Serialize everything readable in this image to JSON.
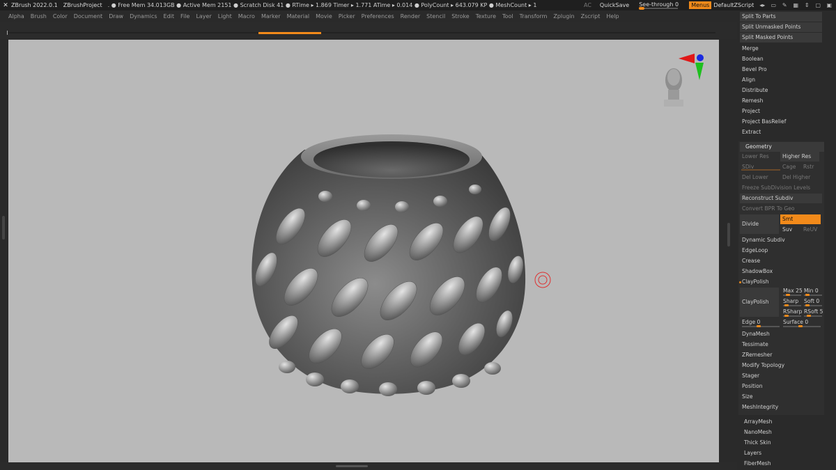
{
  "titlebar": {
    "app": "ZBrush 2022.0.1",
    "project": "ZBrushProject",
    "stats": ". ● Free Mem 34.013GB ● Active Mem 2151 ● Scratch Disk 41 ● RTime ▸ 1.869 Timer ▸ 1.771 ATime ▸ 0.014 ● PolyCount ▸ 643.079 KP ● MeshCount ▸ 1",
    "ac": "AC",
    "quicksave": "QuickSave",
    "seethrough": "See-through  0",
    "menus": "Menus",
    "default_zscript": "DefaultZScript"
  },
  "menubar": [
    "Alpha",
    "Brush",
    "Color",
    "Document",
    "Draw",
    "Dynamics",
    "Edit",
    "File",
    "Layer",
    "Light",
    "Macro",
    "Marker",
    "Material",
    "Movie",
    "Picker",
    "Preferences",
    "Render",
    "Stencil",
    "Stroke",
    "Texture",
    "Tool",
    "Transform",
    "Zplugin",
    "Zscript",
    "Help"
  ],
  "subtool_top": [
    "Split To Parts",
    "Split Unmasked Points",
    "Split Masked Points"
  ],
  "subtool_list": [
    "Merge",
    "Boolean",
    "Bevel Pro",
    "Align",
    "Distribute",
    "Remesh",
    "Project",
    "Project BasRelief",
    "Extract"
  ],
  "geometry": {
    "header": "Geometry",
    "lower_res": "Lower Res",
    "higher_res": "Higher Res",
    "sdiv": "SDiv",
    "cage": "Cage",
    "rstr": "Rstr",
    "del_lower": "Del Lower",
    "del_higher": "Del Higher",
    "freeze": "Freeze SubDivision Levels",
    "reconstruct": "Reconstruct Subdiv",
    "convert_bpr": "Convert BPR To Geo",
    "divide": "Divide",
    "smt": "Smt",
    "suv": "Suv",
    "reuv": "ReUV",
    "items": [
      "Dynamic Subdiv",
      "EdgeLoop",
      "Crease",
      "ShadowBox"
    ],
    "claypolish_toggle": "ClayPolish",
    "claypolish": "ClayPolish",
    "max": "Max 25",
    "min": "Min 0",
    "sharp": "Sharp",
    "soft": "Soft 0",
    "rsharp": "RSharp",
    "rsoft": "RSoft 5",
    "edge": "Edge 0",
    "surface": "Surface 0",
    "items2": [
      "DynaMesh",
      "Tessimate",
      "ZRemesher",
      "Modify Topology",
      "Stager",
      "Position",
      "Size",
      "MeshIntegrity"
    ]
  },
  "bottom_items": [
    "ArrayMesh",
    "NanoMesh",
    "Thick Skin",
    "Layers",
    "FiberMesh"
  ],
  "colors": {
    "accent": "#f28a1a",
    "viewport_bg": "#b9b9b9",
    "panel_bg": "#2a2a2a",
    "button_bg": "#3a3a3a"
  },
  "icons": {
    "logo": "zbrush-logo-icon",
    "head": "navigation-head-icon",
    "axis": "axis-gizmo-icon",
    "cursor": "brush-cursor-icon"
  }
}
